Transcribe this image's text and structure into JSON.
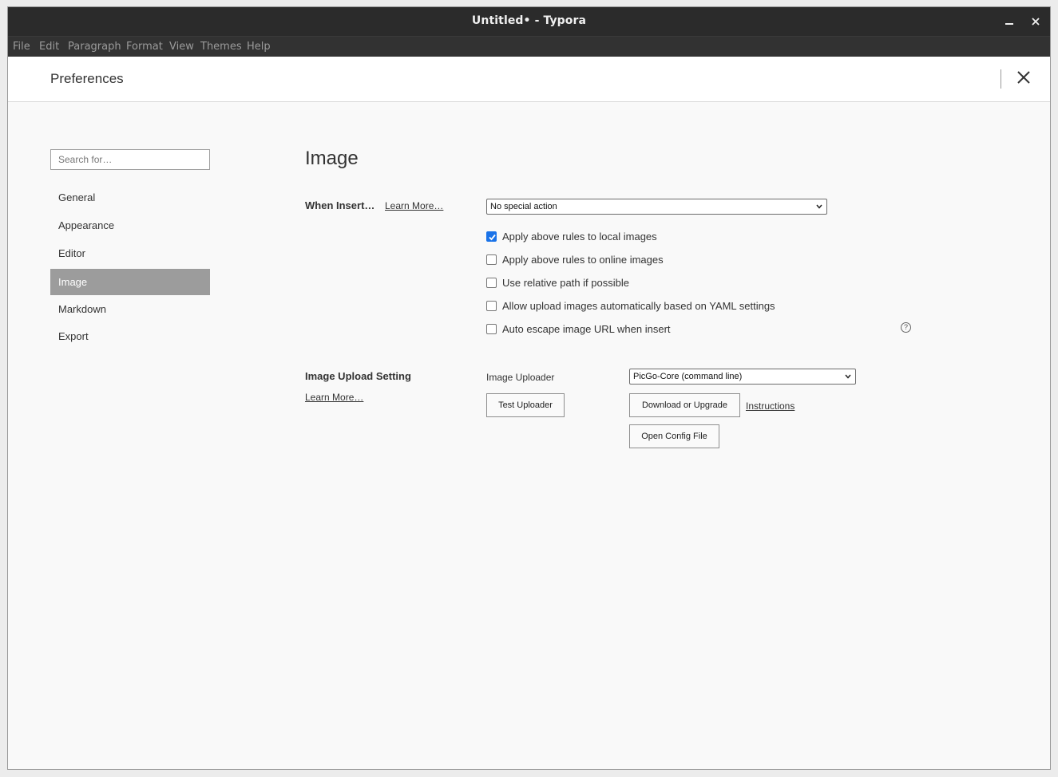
{
  "window": {
    "title": "Untitled• - Typora",
    "minimize_glyph": "—",
    "close_glyph": "✕"
  },
  "menu": [
    "File",
    "Edit",
    "Paragraph",
    "Format",
    "View",
    "Themes",
    "Help"
  ],
  "preferences": {
    "title": "Preferences",
    "search_placeholder": "Search for…",
    "nav": [
      "General",
      "Appearance",
      "Editor",
      "Image",
      "Markdown",
      "Export"
    ],
    "active_nav": "Image"
  },
  "image": {
    "section_title": "Image",
    "when_insert": {
      "label": "When Insert…",
      "learn_more": "Learn More…",
      "selected": "No special action"
    },
    "options": [
      {
        "label": "Apply above rules to local images",
        "checked": true
      },
      {
        "label": "Apply above rules to online images",
        "checked": false
      },
      {
        "label": "Use relative path if possible",
        "checked": false
      },
      {
        "label": "Allow upload images automatically based on YAML settings",
        "checked": false
      },
      {
        "label": "Auto escape image URL when insert",
        "checked": false
      }
    ],
    "help_glyph": "?",
    "upload": {
      "label": "Image Upload Setting",
      "learn_more": "Learn More…",
      "uploader_label": "Image Uploader",
      "uploader_selected": "PicGo-Core (command line)",
      "test_button": "Test Uploader",
      "download_button": "Download or Upgrade",
      "instructions_link": "Instructions",
      "open_config_button": "Open Config File"
    }
  },
  "colors": {
    "titlebar": "#2b2b2b",
    "active_nav": "#9c9c9c",
    "checkbox_accent": "#1a73e8"
  }
}
